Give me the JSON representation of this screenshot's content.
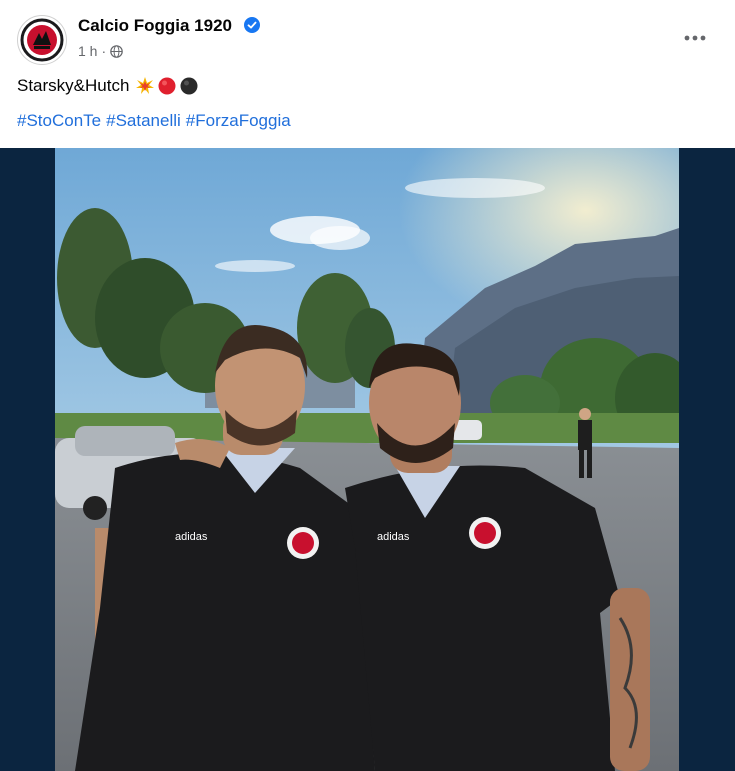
{
  "post": {
    "page_name": "Calcio Foggia 1920",
    "time": "1 h",
    "separator": "·",
    "verified_icon": "verified-badge-icon",
    "privacy_icon": "globe-icon",
    "more_icon": "more-options-icon",
    "caption": "Starsky&Hutch",
    "caption_emojis": [
      "collision-emoji",
      "red-circle-emoji",
      "black-circle-emoji"
    ],
    "hashtags": [
      "#StoConTe",
      "#Satanelli",
      "#ForzaFoggia"
    ],
    "colors": {
      "hashtag": "#216fdb",
      "verified": "#1877f2",
      "media_background": "#0b2540",
      "jersey": "#1b1b1d",
      "club_red": "#c8102e"
    }
  }
}
